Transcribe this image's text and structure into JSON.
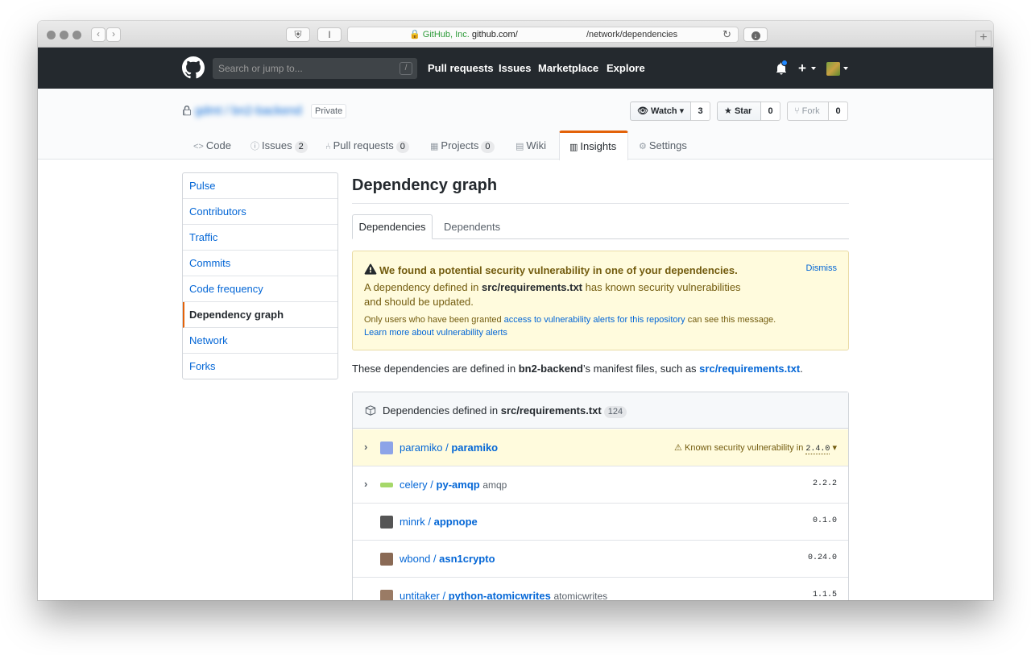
{
  "browser": {
    "address_secure": "GitHub, Inc.",
    "address_host": "github.com/",
    "address_path": "/network/dependencies"
  },
  "header": {
    "search_placeholder": "Search or jump to...",
    "search_key": "/",
    "nav": [
      "Pull requests",
      "Issues",
      "Marketplace",
      "Explore"
    ],
    "plus": "+"
  },
  "repo": {
    "name": "gdmt / bn2-backend",
    "visibility": "Private",
    "watch_label": "Watch",
    "watch_count": "3",
    "star_label": "Star",
    "star_count": "0",
    "fork_label": "Fork",
    "fork_count": "0"
  },
  "reponav": {
    "code": "Code",
    "issues": "Issues",
    "issues_count": "2",
    "pulls": "Pull requests",
    "pulls_count": "0",
    "projects": "Projects",
    "projects_count": "0",
    "wiki": "Wiki",
    "insights": "Insights",
    "settings": "Settings"
  },
  "sidebar": {
    "items": [
      {
        "label": "Pulse"
      },
      {
        "label": "Contributors"
      },
      {
        "label": "Traffic"
      },
      {
        "label": "Commits"
      },
      {
        "label": "Code frequency"
      },
      {
        "label": "Dependency graph"
      },
      {
        "label": "Network"
      },
      {
        "label": "Forks"
      }
    ]
  },
  "main": {
    "title": "Dependency graph",
    "tabs": [
      "Dependencies",
      "Dependents"
    ],
    "alert": {
      "headline": "We found a potential security vulnerability in one of your dependencies.",
      "dismiss": "Dismiss",
      "body_pre": "A dependency defined in ",
      "body_file": "src/requirements.txt",
      "body_post": " has known security vulnerabilities",
      "body_line2": "and should be updated.",
      "small_pre": "Only users who have been granted ",
      "small_link": "access to vulnerability alerts for this repository",
      "small_post": " can see this message.",
      "learn_more": "Learn more about vulnerability alerts"
    },
    "manifest": {
      "pre": "These dependencies are defined in ",
      "repo": "bn2-backend",
      "mid": "’s manifest files, such as ",
      "file": "src/requirements.txt",
      "post": "."
    },
    "box": {
      "header_pre": "Dependencies defined in ",
      "header_file": "src/requirements.txt",
      "count": "124"
    },
    "deps": [
      {
        "owner": "paramiko",
        "repo": "paramiko",
        "alias": "",
        "vuln_text": "Known security vulnerability in",
        "version": "2.4.0",
        "avatar_color": "#8da4e8"
      },
      {
        "owner": "celery",
        "repo": "py-amqp",
        "alias": "amqp",
        "version": "2.2.2",
        "avatar_color": "#a6d86a"
      },
      {
        "owner": "minrk",
        "repo": "appnope",
        "alias": "",
        "version": "0.1.0",
        "avatar_color": "#555555"
      },
      {
        "owner": "wbond",
        "repo": "asn1crypto",
        "alias": "",
        "version": "0.24.0",
        "avatar_color": "#8a6a55"
      },
      {
        "owner": "untitaker",
        "repo": "python-atomicwrites",
        "alias": "atomicwrites",
        "version": "1.1.5",
        "avatar_color": "#9a7b65"
      }
    ]
  },
  "colors": {
    "accent_orange": "#e36209",
    "link_blue": "#0366d6",
    "header_dark": "#24292e",
    "flash_bg": "#fffbdd"
  }
}
